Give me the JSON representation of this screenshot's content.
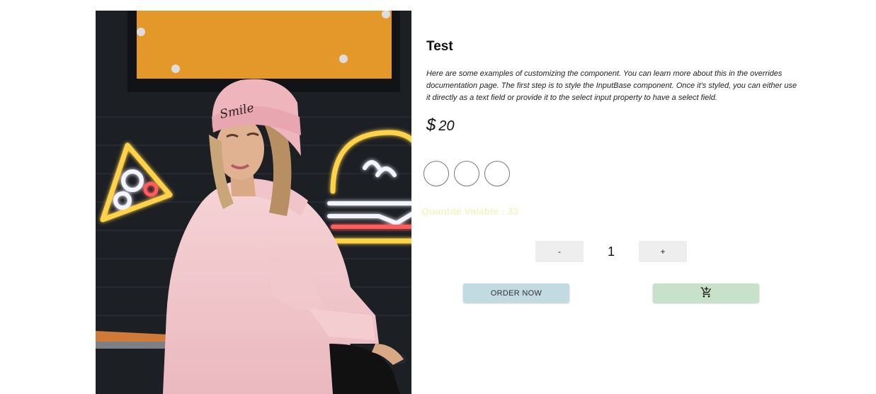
{
  "product": {
    "image_icon": "product-photo",
    "title": "Test",
    "description": "Here are some examples of customizing the component. You can learn more about this in the overrides documentation page. The first step is to style the InputBase component. Once it's styled, you can either use it directly as a text field or provide it to the select input property to have a select field.",
    "price_currency": "$",
    "price_amount": "20",
    "color_options": [
      {
        "color": "#ffffff"
      },
      {
        "color": "#ffffff"
      },
      {
        "color": "#ffffff"
      }
    ],
    "stock_text": "Quantité Valable : 33",
    "stock_color": "#f3f6c4"
  },
  "quantity": {
    "decrement_label": "-",
    "value": "1",
    "increment_label": "+"
  },
  "actions": {
    "order_label": "ORDER NOW",
    "order_color": "#c2dbe3",
    "cart_icon": "add-shopping-cart-icon",
    "cart_color": "#c7e2c8"
  }
}
